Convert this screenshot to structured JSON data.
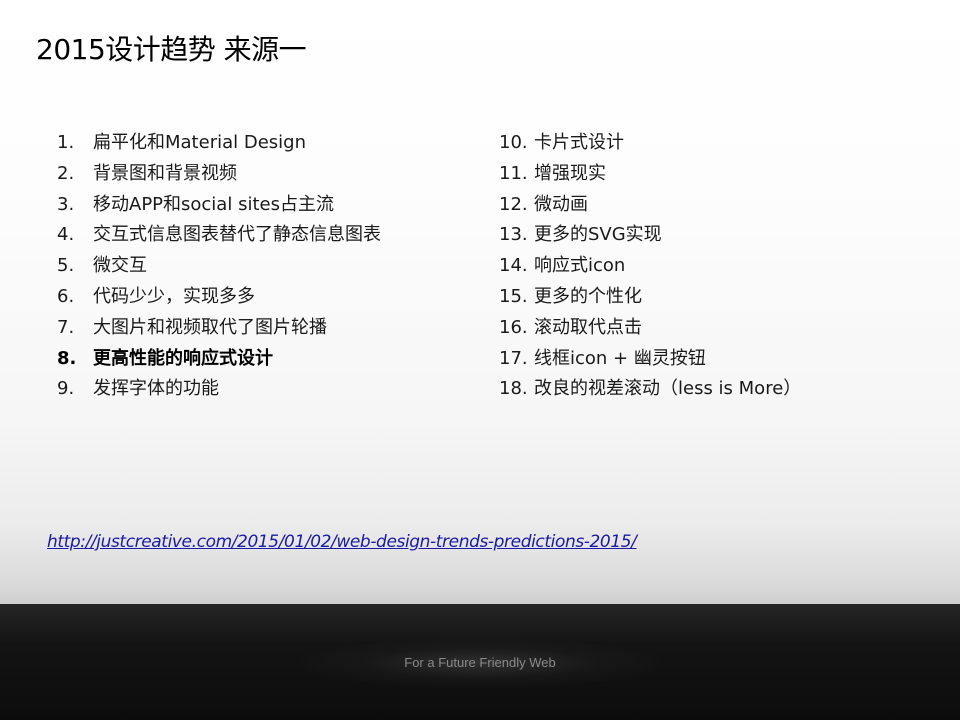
{
  "slide": {
    "title": "2015设计趋势 来源一",
    "left_list": [
      {
        "num": "1.",
        "text": "扁平化和Material Design",
        "bold": false
      },
      {
        "num": "2.",
        "text": "背景图和背景视频",
        "bold": false
      },
      {
        "num": "3.",
        "text": "移动APP和social sites占主流",
        "bold": false
      },
      {
        "num": "4.",
        "text": "交互式信息图表替代了静态信息图表",
        "bold": false
      },
      {
        "num": "5.",
        "text": "微交互",
        "bold": false
      },
      {
        "num": "6.",
        "text": "代码少少，实现多多",
        "bold": false
      },
      {
        "num": "7.",
        "text": "大图片和视频取代了图片轮播",
        "bold": false
      },
      {
        "num": "8.",
        "text": "更高性能的响应式设计",
        "bold": true
      },
      {
        "num": "9.",
        "text": "发挥字体的功能",
        "bold": false
      }
    ],
    "right_list": [
      {
        "num": "10.",
        "text": "卡片式设计"
      },
      {
        "num": "11.",
        "text": "增强现实"
      },
      {
        "num": "12.",
        "text": "微动画"
      },
      {
        "num": "13.",
        "text": "更多的SVG实现"
      },
      {
        "num": "14.",
        "text": "响应式icon"
      },
      {
        "num": "15.",
        "text": "更多的个性化"
      },
      {
        "num": "16.",
        "text": "滚动取代点击"
      },
      {
        "num": "17.",
        "text": "线框icon + 幽灵按钮"
      },
      {
        "num": "18.",
        "text": "改良的视差滚动（less is More）"
      }
    ],
    "source_link": "http://justcreative.com/2015/01/02/web-design-trends-predictions-2015/",
    "footer_text": "For a Future Friendly Web"
  },
  "colors": {
    "link": "#1a1aa6",
    "footer_band": "#141414",
    "footer_text": "#8a8a8a"
  }
}
